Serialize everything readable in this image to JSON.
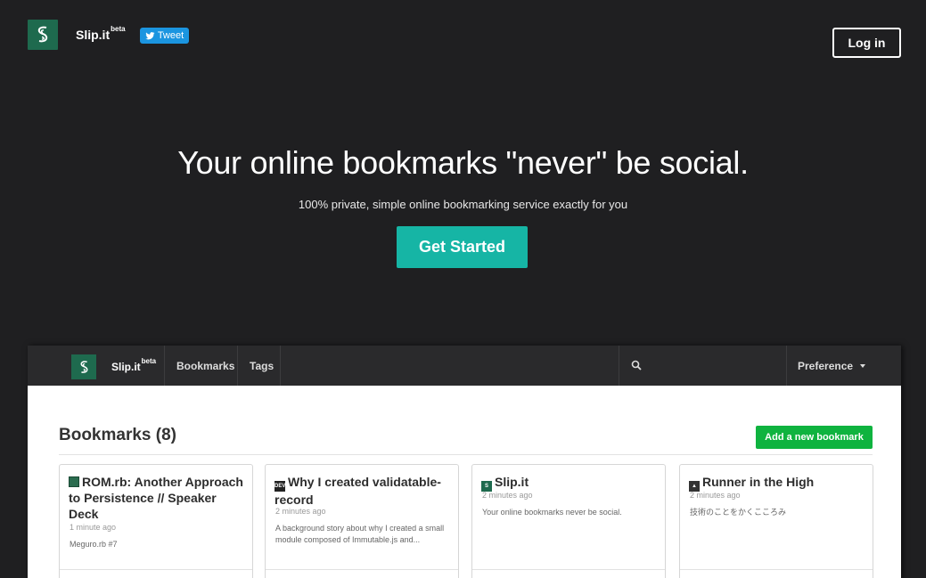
{
  "topnav": {
    "brand": "Slip.it",
    "brand_badge": "beta",
    "tweet_label": "Tweet",
    "login_label": "Log in"
  },
  "hero": {
    "title": "Your online bookmarks \"never\" be social.",
    "subtitle": "100% private, simple online bookmarking service exactly for you",
    "cta_label": "Get Started"
  },
  "preview": {
    "brand": "Slip.it",
    "brand_badge": "beta",
    "nav": [
      "Bookmarks",
      "Tags"
    ],
    "search_icon": "search-icon",
    "preference_label": "Preference",
    "page_title": "Bookmarks (8)",
    "add_button": "Add a new bookmark",
    "cards": [
      {
        "title": "ROM.rb: Another Approach to Persistence // Speaker Deck",
        "favicon": "slides-icon",
        "time": "1 minute ago",
        "desc": "Meguro.rb #7"
      },
      {
        "title": "Why I created validatable-record",
        "favicon": "dev-icon",
        "favicon_text": "DEV",
        "time": "2 minutes ago",
        "desc": "A background story about why I created a small module composed of Immutable.js and..."
      },
      {
        "title": "Slip.it",
        "favicon": "slipit-icon",
        "time": "2 minutes ago",
        "desc": "Your online bookmarks never be social."
      },
      {
        "title": "Runner in the High",
        "favicon": "runner-icon",
        "time": "2 minutes ago",
        "desc": "技術のことをかくこころみ"
      }
    ]
  },
  "colors": {
    "background": "#1f1f21",
    "brand_green": "#1e6a4e",
    "cta_teal": "#16b5a5",
    "tweet_blue": "#1b95e0",
    "add_green": "#0fb33f"
  }
}
